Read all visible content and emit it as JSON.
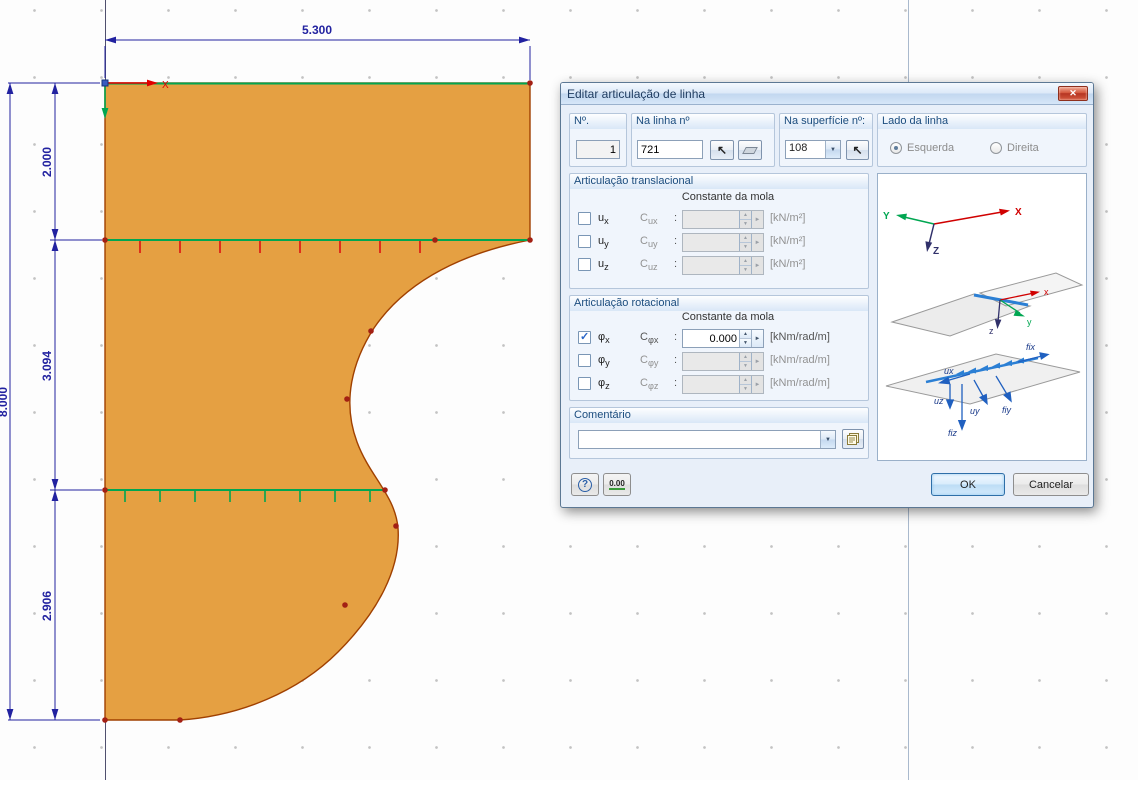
{
  "colors": {
    "surface_fill": "#e5a042",
    "surface_border": "#a04000",
    "hinge_green": "#00a651",
    "tick_red": "#dd1111",
    "dimension_navy": "#2222a0",
    "hinge_blue": "#2b7fd4",
    "titlebar_blue": "#d6e6f8",
    "close_red": "#b53522"
  },
  "canvas": {
    "dimensions": {
      "top": "5.300",
      "total_left": "8.000",
      "segment_1": "2.000",
      "segment_2": "3.094",
      "segment_3": "2.906"
    },
    "axis_x_label": "X"
  },
  "dialog": {
    "title": "Editar articulação de linha",
    "header": {
      "no_label": "Nº.",
      "no_value": "1",
      "line_label": "Na linha nº",
      "line_value": "721",
      "surface_label": "Na superfície nº:",
      "surface_value": "108",
      "side_label": "Lado da linha",
      "side_options": [
        {
          "label": "Esquerda",
          "selected": true
        },
        {
          "label": "Direita",
          "selected": false
        }
      ]
    },
    "translational": {
      "title": "Articulação translacional",
      "spring_header": "Constante da mola",
      "rows": [
        {
          "sym": "u",
          "sub": "x",
          "c": "C",
          "csub": "ux",
          "colon": ":",
          "value": "",
          "unit": "[kN/m²]",
          "checked": false
        },
        {
          "sym": "u",
          "sub": "y",
          "c": "C",
          "csub": "uy",
          "colon": ":",
          "value": "",
          "unit": "[kN/m²]",
          "checked": false
        },
        {
          "sym": "u",
          "sub": "z",
          "c": "C",
          "csub": "uz",
          "colon": ":",
          "value": "",
          "unit": "[kN/m²]",
          "checked": false
        }
      ]
    },
    "rotational": {
      "title": "Articulação rotacional",
      "spring_header": "Constante da mola",
      "rows": [
        {
          "sym": "φ",
          "sub": "x",
          "c": "C",
          "csub": "φx",
          "colon": ":",
          "value": "0.000",
          "unit": "[kNm/rad/m]",
          "checked": true
        },
        {
          "sym": "φ",
          "sub": "y",
          "c": "C",
          "csub": "φy",
          "colon": ":",
          "value": "",
          "unit": "[kNm/rad/m]",
          "checked": false
        },
        {
          "sym": "φ",
          "sub": "z",
          "c": "C",
          "csub": "φz",
          "colon": ":",
          "value": "",
          "unit": "[kNm/rad/m]",
          "checked": false
        }
      ]
    },
    "comment": {
      "title": "Comentário",
      "value": ""
    },
    "buttons": {
      "ok": "OK",
      "cancel": "Cancelar",
      "help": "?",
      "preset": "0.00"
    },
    "panel": {
      "axes": {
        "x": "X",
        "y": "Y",
        "z": "Z"
      },
      "hinge_axes": {
        "x": "x",
        "y": "y",
        "z": "z"
      },
      "dof": {
        "fix": "fix",
        "ux": "ux",
        "uy": "uy",
        "uz": "uz",
        "fiy": "fiy",
        "fiz": "fiz"
      }
    }
  },
  "icons": {
    "close": "✕",
    "dropdown": "▼",
    "spin_up": "▲",
    "spin_down": "▼",
    "side": "►",
    "pick": "↖"
  }
}
